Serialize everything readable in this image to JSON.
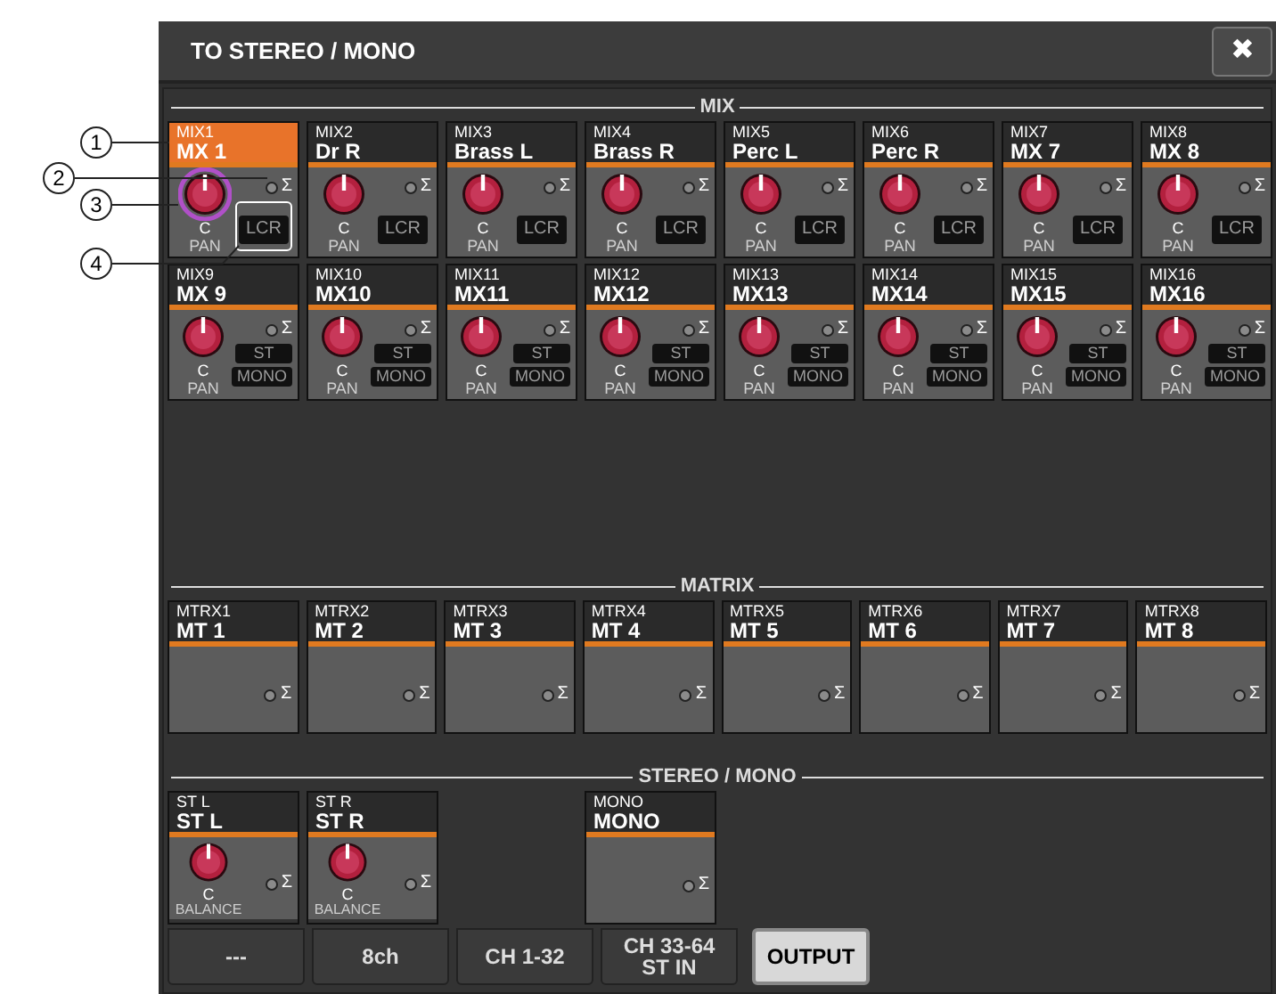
{
  "window": {
    "title": "TO STEREO / MONO",
    "close": "✖"
  },
  "callouts": [
    "1",
    "2",
    "3",
    "4"
  ],
  "mix": {
    "label": "MIX",
    "strips": [
      {
        "label": "MIX1",
        "name": "MX 1",
        "selected": true,
        "kind": "lcr",
        "sum": "Σ",
        "pan": "C",
        "knob_label": "PAN",
        "button": "LCR"
      },
      {
        "label": "MIX2",
        "name": "Dr R",
        "selected": false,
        "kind": "lcr",
        "sum": "Σ",
        "pan": "C",
        "knob_label": "PAN",
        "button": "LCR"
      },
      {
        "label": "MIX3",
        "name": "Brass L",
        "selected": false,
        "kind": "lcr",
        "sum": "Σ",
        "pan": "C",
        "knob_label": "PAN",
        "button": "LCR"
      },
      {
        "label": "MIX4",
        "name": "Brass R",
        "selected": false,
        "kind": "lcr",
        "sum": "Σ",
        "pan": "C",
        "knob_label": "PAN",
        "button": "LCR"
      },
      {
        "label": "MIX5",
        "name": "Perc L",
        "selected": false,
        "kind": "lcr",
        "sum": "Σ",
        "pan": "C",
        "knob_label": "PAN",
        "button": "LCR"
      },
      {
        "label": "MIX6",
        "name": "Perc R",
        "selected": false,
        "kind": "lcr",
        "sum": "Σ",
        "pan": "C",
        "knob_label": "PAN",
        "button": "LCR"
      },
      {
        "label": "MIX7",
        "name": "MX 7",
        "selected": false,
        "kind": "lcr",
        "sum": "Σ",
        "pan": "C",
        "knob_label": "PAN",
        "button": "LCR"
      },
      {
        "label": "MIX8",
        "name": "MX 8",
        "selected": false,
        "kind": "lcr",
        "sum": "Σ",
        "pan": "C",
        "knob_label": "PAN",
        "button": "LCR"
      },
      {
        "label": "MIX9",
        "name": "MX 9",
        "selected": false,
        "kind": "st_mono",
        "sum": "Σ",
        "pan": "C",
        "knob_label": "PAN",
        "button": "ST",
        "button2": "MONO"
      },
      {
        "label": "MIX10",
        "name": "MX10",
        "selected": false,
        "kind": "st_mono",
        "sum": "Σ",
        "pan": "C",
        "knob_label": "PAN",
        "button": "ST",
        "button2": "MONO"
      },
      {
        "label": "MIX11",
        "name": "MX11",
        "selected": false,
        "kind": "st_mono",
        "sum": "Σ",
        "pan": "C",
        "knob_label": "PAN",
        "button": "ST",
        "button2": "MONO"
      },
      {
        "label": "MIX12",
        "name": "MX12",
        "selected": false,
        "kind": "st_mono",
        "sum": "Σ",
        "pan": "C",
        "knob_label": "PAN",
        "button": "ST",
        "button2": "MONO"
      },
      {
        "label": "MIX13",
        "name": "MX13",
        "selected": false,
        "kind": "st_mono",
        "sum": "Σ",
        "pan": "C",
        "knob_label": "PAN",
        "button": "ST",
        "button2": "MONO"
      },
      {
        "label": "MIX14",
        "name": "MX14",
        "selected": false,
        "kind": "st_mono",
        "sum": "Σ",
        "pan": "C",
        "knob_label": "PAN",
        "button": "ST",
        "button2": "MONO"
      },
      {
        "label": "MIX15",
        "name": "MX15",
        "selected": false,
        "kind": "st_mono",
        "sum": "Σ",
        "pan": "C",
        "knob_label": "PAN",
        "button": "ST",
        "button2": "MONO"
      },
      {
        "label": "MIX16",
        "name": "MX16",
        "selected": false,
        "kind": "st_mono",
        "sum": "Σ",
        "pan": "C",
        "knob_label": "PAN",
        "button": "ST",
        "button2": "MONO"
      }
    ]
  },
  "matrix": {
    "label": "MATRIX",
    "strips": [
      {
        "label": "MTRX1",
        "name": "MT 1",
        "sum": "Σ"
      },
      {
        "label": "MTRX2",
        "name": "MT 2",
        "sum": "Σ"
      },
      {
        "label": "MTRX3",
        "name": "MT 3",
        "sum": "Σ"
      },
      {
        "label": "MTRX4",
        "name": "MT 4",
        "sum": "Σ"
      },
      {
        "label": "MTRX5",
        "name": "MT 5",
        "sum": "Σ"
      },
      {
        "label": "MTRX6",
        "name": "MT 6",
        "sum": "Σ"
      },
      {
        "label": "MTRX7",
        "name": "MT 7",
        "sum": "Σ"
      },
      {
        "label": "MTRX8",
        "name": "MT 8",
        "sum": "Σ"
      }
    ]
  },
  "stereo_mono": {
    "label": "STEREO / MONO",
    "strips": [
      {
        "kind": "balance",
        "label": "ST L",
        "name": "ST L",
        "sum": "Σ",
        "pan": "C",
        "knob_label": "BALANCE"
      },
      {
        "kind": "balance",
        "label": "ST R",
        "name": "ST R",
        "sum": "Σ",
        "pan": "C",
        "knob_label": "BALANCE"
      },
      {
        "kind": "mono",
        "label": "MONO",
        "name": "MONO",
        "sum": "Σ"
      }
    ]
  },
  "tabs": [
    {
      "label": "---",
      "selected": false
    },
    {
      "label": "8ch",
      "selected": false
    },
    {
      "label": "CH 1-32",
      "selected": false
    },
    {
      "label": "CH 33-64\nST IN",
      "selected": false
    },
    {
      "label": "OUTPUT",
      "selected": true
    }
  ]
}
